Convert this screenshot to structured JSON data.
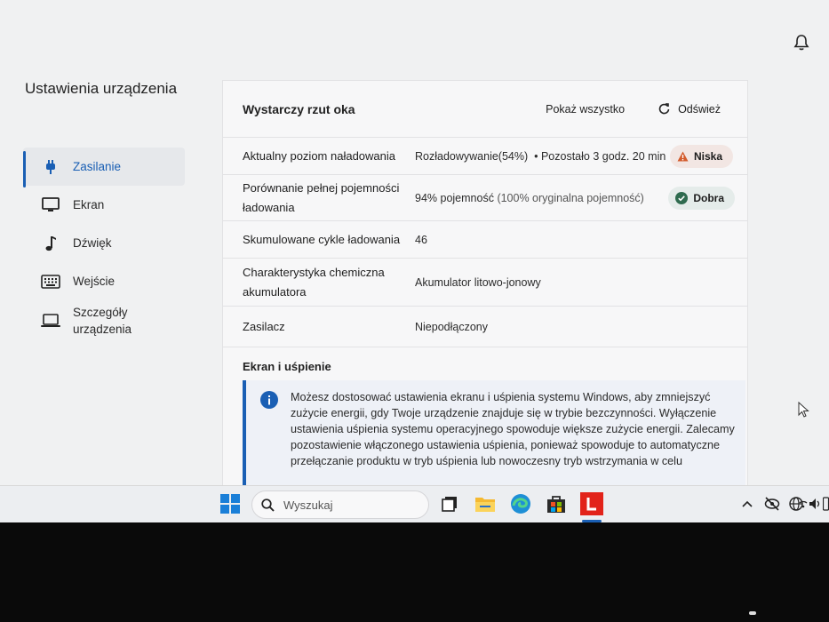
{
  "sidebar": {
    "title": "Ustawienia urządzenia",
    "items": [
      {
        "label": "Zasilanie",
        "icon": "plug-icon",
        "active": true
      },
      {
        "label": "Ekran",
        "icon": "monitor-icon"
      },
      {
        "label": "Dźwięk",
        "icon": "music-note-icon"
      },
      {
        "label": "Wejście",
        "icon": "keyboard-icon"
      },
      {
        "label": "Szczegóły urządzenia",
        "icon": "laptop-icon"
      }
    ]
  },
  "panel": {
    "title": "Wystarczy rzut oka",
    "show_all": "Pokaż wszystko",
    "refresh": "Odśwież",
    "rows": [
      {
        "label": "Aktualny poziom naładowania",
        "value": "Rozładowywanie(54%)",
        "extra": "•  Pozostało 3 godz. 20 min",
        "badge": "Niska"
      },
      {
        "label": "Porównanie pełnej pojemności ładowania",
        "value": "94% pojemność",
        "extra": "(100% oryginalna pojemność)",
        "badge": "Dobra"
      },
      {
        "label": "Skumulowane cykle ładowania",
        "value": "46"
      },
      {
        "label": "Charakterystyka chemiczna akumulatora",
        "value": "Akumulator litowo-jonowy"
      },
      {
        "label": "Zasilacz",
        "value": "Niepodłączony"
      }
    ],
    "section_title": "Ekran i uśpienie",
    "info_text": "Możesz dostosować ustawienia ekranu i uśpienia systemu Windows, aby zmniejszyć zużycie energii, gdy Twoje urządzenie znajduje się w trybie bezczynności. Wyłączenie ustawienia uśpienia systemu operacyjnego spowoduje większe zużycie energii. Zalecamy pozostawienie włączonego ustawienia uśpienia, ponieważ spowoduje to automatyczne przełączanie produktu w tryb uśpienia lub nowoczesny tryb wstrzymania w celu"
  },
  "taskbar": {
    "search_placeholder": "Wyszukaj",
    "apps": [
      "windows-start-icon",
      "task-view-icon",
      "file-explorer-icon",
      "edge-icon",
      "store-icon",
      "lenovo-vantage-icon"
    ],
    "tray": [
      "chevron-up-icon",
      "eye-off-icon",
      "globe-icon",
      "wifi-icon",
      "volume-icon",
      "battery-icon"
    ]
  },
  "colors": {
    "accent": "#1a5fb4",
    "warn": "#d35b2c",
    "good": "#2f6b4f",
    "lenovo": "#e2231a"
  }
}
